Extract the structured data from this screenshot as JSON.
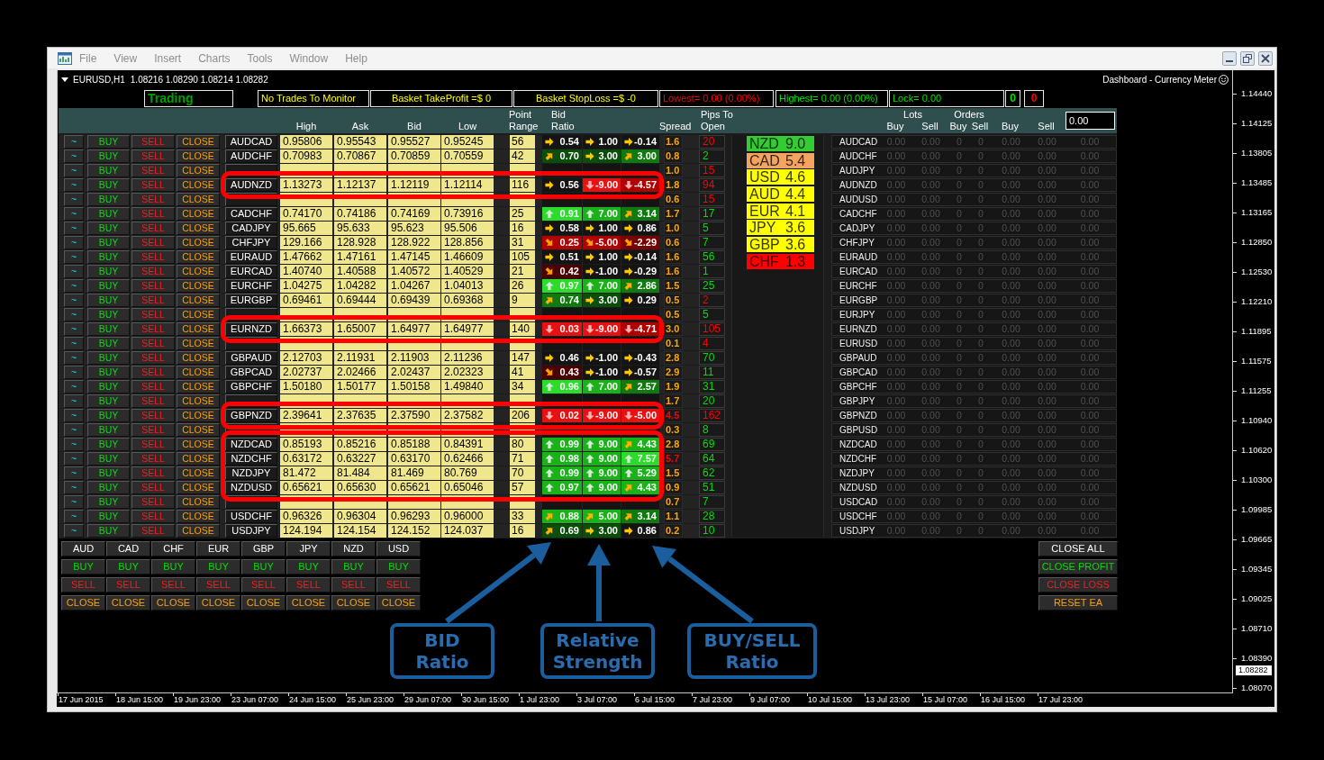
{
  "window": {
    "menu": [
      "File",
      "View",
      "Insert",
      "Charts",
      "Tools",
      "Window",
      "Help"
    ]
  },
  "chart": {
    "symbol": "EURUSD,H1",
    "quote": "1.08216 1.08290 1.08214 1.08282",
    "indicator": "Dashboard - Currency Meter",
    "price_labels": [
      "1.14440",
      "1.14125",
      "1.13805",
      "1.13485",
      "1.13165",
      "1.12850",
      "1.12530",
      "1.12210",
      "1.11895",
      "1.11575",
      "1.11255",
      "1.10940",
      "1.10620",
      "1.10300",
      "1.09985",
      "1.09665",
      "1.09345",
      "1.09025",
      "1.08710",
      "1.08390",
      "1.08070"
    ],
    "current_price": "1.08282",
    "time_labels": [
      "17 Jun 2015",
      "18 Jun 15:00",
      "19 Jun 23:00",
      "23 Jun 07:00",
      "24 Jun 15:00",
      "25 Jun 23:00",
      "29 Jun 07:00",
      "30 Jun 15:00",
      "1 Jul 23:00",
      "3 Jul 07:00",
      "6 Jul 15:00",
      "7 Jul 23:00",
      "9 Jul 07:00",
      "10 Jul 15:00",
      "13 Jul 23:00",
      "15 Jul 07:00",
      "16 Jul 15:00",
      "17 Jul 23:00"
    ]
  },
  "status_boxes": [
    {
      "text": "Trading",
      "color": "#00a000"
    },
    {
      "text": "No Trades To Monitor",
      "color": "#ffff00"
    },
    {
      "text": "Basket TakeProfit =$ 0",
      "color": "#ffff00"
    },
    {
      "text": "Basket StopLoss =$ -0",
      "color": "#ffff00"
    },
    {
      "text": "Lowest= 0.00 (0.00%)",
      "color": "#ff0000"
    },
    {
      "text": "Highest= 0.00 (0.00%)",
      "color": "#00e000"
    },
    {
      "text": "Lock= 0.00",
      "color": "#00e000"
    },
    {
      "text": "0",
      "color": "#00e000"
    },
    {
      "text": "0",
      "color": "#ff0000"
    }
  ],
  "table": {
    "headers": [
      [
        "High"
      ],
      [
        "Ask"
      ],
      [
        "Bid"
      ],
      [
        "Low"
      ],
      [
        "Point",
        "Range"
      ],
      [
        "Bid",
        "Ratio"
      ],
      [
        "Spread"
      ],
      [
        "Pips To",
        "Open"
      ]
    ],
    "rows": [
      {
        "buttons": [
          "~",
          "BUY",
          "SELL",
          "CLOSE"
        ],
        "pair": "AUDCAD",
        "high": "0.95806",
        "ask": "0.95543",
        "bid": "0.95527",
        "low": "0.95245",
        "range": "56",
        "ratios": [
          {
            "value": "0.54",
            "kind": "right",
            "color": "#141414"
          },
          {
            "value": "1.00",
            "kind": "right",
            "color": "#141414"
          },
          {
            "value": "-0.14",
            "kind": "right",
            "color": "#141414"
          }
        ],
        "spread": {
          "text": "1.6",
          "color": "#ffa500"
        },
        "pips": {
          "text": "20",
          "color": "#ff0000"
        },
        "highlighted": false
      },
      {
        "buttons": [
          "~",
          "BUY",
          "SELL",
          "CLOSE"
        ],
        "pair": "AUDCHF",
        "high": "0.70983",
        "ask": "0.70867",
        "bid": "0.70859",
        "low": "0.70559",
        "range": "42",
        "ratios": [
          {
            "value": "0.70",
            "kind": "up_right",
            "color": "#0b4d0b"
          },
          {
            "value": "3.00",
            "kind": "right",
            "color": "#0b4d0b"
          },
          {
            "value": "3.00",
            "kind": "up_right",
            "color": "#0f7a0f"
          }
        ],
        "spread": {
          "text": "0.8",
          "color": "#ffa500"
        },
        "pips": {
          "text": "2",
          "color": "#00e000"
        },
        "highlighted": false
      },
      {
        "buttons": [
          "~",
          "BUY",
          "SELL",
          "CLOSE"
        ],
        "spread": {
          "text": "1.0",
          "color": "#ffa500"
        },
        "pips": {
          "text": "15",
          "color": "#ff0000"
        },
        "highlighted": false
      },
      {
        "buttons": [
          "~",
          "BUY",
          "SELL",
          "CLOSE"
        ],
        "pair": "AUDNZD",
        "high": "1.13273",
        "ask": "1.12137",
        "bid": "1.12119",
        "low": "1.12114",
        "range": "116",
        "ratios": [
          {
            "value": "0.56",
            "kind": "right",
            "color": "#141414"
          },
          {
            "value": "-9.00",
            "kind": "down",
            "color": "#e81010"
          },
          {
            "value": "-4.57",
            "kind": "down",
            "color": "#b00000"
          }
        ],
        "spread": {
          "text": "1.8",
          "color": "#ffa500"
        },
        "pips": {
          "text": "94",
          "color": "#ff0000"
        },
        "highlighted": true
      },
      {
        "buttons": [
          "~",
          "BUY",
          "SELL",
          "CLOSE"
        ],
        "spread": {
          "text": "0.6",
          "color": "#ffa500"
        },
        "pips": {
          "text": "15",
          "color": "#ff0000"
        },
        "highlighted": false
      },
      {
        "buttons": [
          "~",
          "BUY",
          "SELL",
          "CLOSE"
        ],
        "pair": "CADCHF",
        "high": "0.74170",
        "ask": "0.74186",
        "bid": "0.74169",
        "low": "0.73916",
        "range": "25",
        "ratios": [
          {
            "value": "0.91",
            "kind": "up",
            "color": "#2bdc2b"
          },
          {
            "value": "7.00",
            "kind": "up",
            "color": "#19b219"
          },
          {
            "value": "3.14",
            "kind": "up_right",
            "color": "#0f7a0f"
          }
        ],
        "spread": {
          "text": "1.7",
          "color": "#ffa500"
        },
        "pips": {
          "text": "17",
          "color": "#00e000"
        },
        "highlighted": false
      },
      {
        "buttons": [
          "~",
          "BUY",
          "SELL",
          "CLOSE"
        ],
        "pair": "CADJPY",
        "high": "95.665",
        "ask": "95.633",
        "bid": "95.623",
        "low": "95.506",
        "range": "16",
        "ratios": [
          {
            "value": "0.58",
            "kind": "right",
            "color": "#141414"
          },
          {
            "value": "1.00",
            "kind": "right",
            "color": "#141414"
          },
          {
            "value": "0.86",
            "kind": "right",
            "color": "#141414"
          }
        ],
        "spread": {
          "text": "1.0",
          "color": "#ffa500"
        },
        "pips": {
          "text": "5",
          "color": "#00e000"
        },
        "highlighted": false
      },
      {
        "buttons": [
          "~",
          "BUY",
          "SELL",
          "CLOSE"
        ],
        "pair": "CHFJPY",
        "high": "129.166",
        "ask": "128.928",
        "bid": "128.922",
        "low": "128.856",
        "range": "31",
        "ratios": [
          {
            "value": "0.25",
            "kind": "down_right",
            "color": "#b00000"
          },
          {
            "value": "-5.00",
            "kind": "down_right",
            "color": "#b00000"
          },
          {
            "value": "-2.29",
            "kind": "down_right",
            "color": "#7a0000"
          }
        ],
        "spread": {
          "text": "0.6",
          "color": "#ffa500"
        },
        "pips": {
          "text": "7",
          "color": "#00e000"
        },
        "highlighted": false
      },
      {
        "buttons": [
          "~",
          "BUY",
          "SELL",
          "CLOSE"
        ],
        "pair": "EURAUD",
        "high": "1.47662",
        "ask": "1.47161",
        "bid": "1.47145",
        "low": "1.46609",
        "range": "105",
        "ratios": [
          {
            "value": "0.51",
            "kind": "right",
            "color": "#141414"
          },
          {
            "value": "1.00",
            "kind": "right",
            "color": "#141414"
          },
          {
            "value": "-0.14",
            "kind": "right",
            "color": "#141414"
          }
        ],
        "spread": {
          "text": "1.6",
          "color": "#ffa500"
        },
        "pips": {
          "text": "56",
          "color": "#00e000"
        },
        "highlighted": false
      },
      {
        "buttons": [
          "~",
          "BUY",
          "SELL",
          "CLOSE"
        ],
        "pair": "EURCAD",
        "high": "1.40740",
        "ask": "1.40588",
        "bid": "1.40572",
        "low": "1.40529",
        "range": "21",
        "ratios": [
          {
            "value": "0.42",
            "kind": "down_right",
            "color": "#4a0000"
          },
          {
            "value": "-1.00",
            "kind": "right",
            "color": "#141414"
          },
          {
            "value": "-0.29",
            "kind": "right",
            "color": "#141414"
          }
        ],
        "spread": {
          "text": "1.6",
          "color": "#ffa500"
        },
        "pips": {
          "text": "1",
          "color": "#00e000"
        },
        "highlighted": false
      },
      {
        "buttons": [
          "~",
          "BUY",
          "SELL",
          "CLOSE"
        ],
        "pair": "EURCHF",
        "high": "1.04275",
        "ask": "1.04282",
        "bid": "1.04267",
        "low": "1.04013",
        "range": "26",
        "ratios": [
          {
            "value": "0.97",
            "kind": "up",
            "color": "#2bdc2b"
          },
          {
            "value": "7.00",
            "kind": "up",
            "color": "#19b219"
          },
          {
            "value": "2.86",
            "kind": "up_right",
            "color": "#0f7a0f"
          }
        ],
        "spread": {
          "text": "1.5",
          "color": "#ffa500"
        },
        "pips": {
          "text": "25",
          "color": "#00e000"
        },
        "highlighted": false
      },
      {
        "buttons": [
          "~",
          "BUY",
          "SELL",
          "CLOSE"
        ],
        "pair": "EURGBP",
        "high": "0.69461",
        "ask": "0.69444",
        "bid": "0.69439",
        "low": "0.69368",
        "range": "9",
        "ratios": [
          {
            "value": "0.74",
            "kind": "up_right",
            "color": "#0f7a0f"
          },
          {
            "value": "3.00",
            "kind": "right",
            "color": "#0b4d0b"
          },
          {
            "value": "0.29",
            "kind": "right",
            "color": "#141414"
          }
        ],
        "spread": {
          "text": "0.5",
          "color": "#ffa500"
        },
        "pips": {
          "text": "2",
          "color": "#ff0000"
        },
        "highlighted": false
      },
      {
        "buttons": [
          "~",
          "BUY",
          "SELL",
          "CLOSE"
        ],
        "spread": {
          "text": "0.5",
          "color": "#ffa500"
        },
        "pips": {
          "text": "5",
          "color": "#00e000"
        },
        "highlighted": false
      },
      {
        "buttons": [
          "~",
          "BUY",
          "SELL",
          "CLOSE"
        ],
        "pair": "EURNZD",
        "high": "1.66373",
        "ask": "1.65007",
        "bid": "1.64977",
        "low": "1.64977",
        "range": "140",
        "ratios": [
          {
            "value": "0.03",
            "kind": "down",
            "color": "#e81010"
          },
          {
            "value": "-9.00",
            "kind": "down",
            "color": "#e81010"
          },
          {
            "value": "-4.71",
            "kind": "down",
            "color": "#b00000"
          }
        ],
        "spread": {
          "text": "3.0",
          "color": "#ffa500"
        },
        "pips": {
          "text": "105",
          "color": "#ff0000"
        },
        "highlighted": true
      },
      {
        "buttons": [
          "~",
          "BUY",
          "SELL",
          "CLOSE"
        ],
        "spread": {
          "text": "0.1",
          "color": "#ffa500"
        },
        "pips": {
          "text": "4",
          "color": "#ff0000"
        },
        "highlighted": false
      },
      {
        "buttons": [
          "~",
          "BUY",
          "SELL",
          "CLOSE"
        ],
        "pair": "GBPAUD",
        "high": "2.12703",
        "ask": "2.11931",
        "bid": "2.11903",
        "low": "2.11236",
        "range": "147",
        "ratios": [
          {
            "value": "0.46",
            "kind": "right",
            "color": "#141414"
          },
          {
            "value": "-1.00",
            "kind": "right",
            "color": "#141414"
          },
          {
            "value": "-0.43",
            "kind": "right",
            "color": "#141414"
          }
        ],
        "spread": {
          "text": "2.8",
          "color": "#ffa500"
        },
        "pips": {
          "text": "70",
          "color": "#00e000"
        },
        "highlighted": false
      },
      {
        "buttons": [
          "~",
          "BUY",
          "SELL",
          "CLOSE"
        ],
        "pair": "GBPCAD",
        "high": "2.02737",
        "ask": "2.02466",
        "bid": "2.02437",
        "low": "2.02323",
        "range": "41",
        "ratios": [
          {
            "value": "0.43",
            "kind": "down_right",
            "color": "#4a0000"
          },
          {
            "value": "-1.00",
            "kind": "right",
            "color": "#141414"
          },
          {
            "value": "-0.57",
            "kind": "right",
            "color": "#141414"
          }
        ],
        "spread": {
          "text": "2.9",
          "color": "#ffa500"
        },
        "pips": {
          "text": "11",
          "color": "#00e000"
        },
        "highlighted": false
      },
      {
        "buttons": [
          "~",
          "BUY",
          "SELL",
          "CLOSE"
        ],
        "pair": "GBPCHF",
        "high": "1.50180",
        "ask": "1.50177",
        "bid": "1.50158",
        "low": "1.49840",
        "range": "34",
        "ratios": [
          {
            "value": "0.96",
            "kind": "up",
            "color": "#2bdc2b"
          },
          {
            "value": "7.00",
            "kind": "up",
            "color": "#19b219"
          },
          {
            "value": "2.57",
            "kind": "up_right",
            "color": "#0f7a0f"
          }
        ],
        "spread": {
          "text": "1.9",
          "color": "#ffa500"
        },
        "pips": {
          "text": "31",
          "color": "#00e000"
        },
        "highlighted": false
      },
      {
        "buttons": [
          "~",
          "BUY",
          "SELL",
          "CLOSE"
        ],
        "spread": {
          "text": "1.7",
          "color": "#ffa500"
        },
        "pips": {
          "text": "20",
          "color": "#00e000"
        },
        "highlighted": false
      },
      {
        "buttons": [
          "~",
          "BUY",
          "SELL",
          "CLOSE"
        ],
        "pair": "GBPNZD",
        "high": "2.39641",
        "ask": "2.37635",
        "bid": "2.37590",
        "low": "2.37582",
        "range": "206",
        "ratios": [
          {
            "value": "0.02",
            "kind": "down",
            "color": "#e81010"
          },
          {
            "value": "-9.00",
            "kind": "down",
            "color": "#e81010"
          },
          {
            "value": "-5.00",
            "kind": "down",
            "color": "#e81010"
          }
        ],
        "spread": {
          "text": "4.5",
          "color": "#ff0000"
        },
        "pips": {
          "text": "162",
          "color": "#ff0000"
        },
        "highlighted": true
      },
      {
        "buttons": [
          "~",
          "BUY",
          "SELL",
          "CLOSE"
        ],
        "spread": {
          "text": "0.3",
          "color": "#ffa500"
        },
        "pips": {
          "text": "8",
          "color": "#00e000"
        },
        "highlighted": false
      },
      {
        "buttons": [
          "~",
          "BUY",
          "SELL",
          "CLOSE"
        ],
        "pair": "NZDCAD",
        "high": "0.85193",
        "ask": "0.85216",
        "bid": "0.85188",
        "low": "0.84391",
        "range": "80",
        "ratios": [
          {
            "value": "0.99",
            "kind": "up",
            "color": "#19b219"
          },
          {
            "value": "9.00",
            "kind": "up",
            "color": "#19b219"
          },
          {
            "value": "4.43",
            "kind": "up_right",
            "color": "#19b219"
          }
        ],
        "spread": {
          "text": "2.8",
          "color": "#ffa500"
        },
        "pips": {
          "text": "69",
          "color": "#00e000"
        },
        "highlighted": true
      },
      {
        "buttons": [
          "~",
          "BUY",
          "SELL",
          "CLOSE"
        ],
        "pair": "NZDCHF",
        "high": "0.63172",
        "ask": "0.63227",
        "bid": "0.63170",
        "low": "0.62466",
        "range": "71",
        "ratios": [
          {
            "value": "0.98",
            "kind": "up",
            "color": "#19b219"
          },
          {
            "value": "9.00",
            "kind": "up",
            "color": "#19b219"
          },
          {
            "value": "7.57",
            "kind": "up",
            "color": "#2bdc2b"
          }
        ],
        "spread": {
          "text": "5.7",
          "color": "#ff0000"
        },
        "pips": {
          "text": "64",
          "color": "#00e000"
        },
        "highlighted": true
      },
      {
        "buttons": [
          "~",
          "BUY",
          "SELL",
          "CLOSE"
        ],
        "pair": "NZDJPY",
        "high": "81.472",
        "ask": "81.484",
        "bid": "81.469",
        "low": "80.769",
        "range": "70",
        "ratios": [
          {
            "value": "0.99",
            "kind": "up",
            "color": "#19b219"
          },
          {
            "value": "9.00",
            "kind": "up",
            "color": "#19b219"
          },
          {
            "value": "5.29",
            "kind": "up",
            "color": "#19b219"
          }
        ],
        "spread": {
          "text": "1.5",
          "color": "#ffa500"
        },
        "pips": {
          "text": "62",
          "color": "#00e000"
        },
        "highlighted": true
      },
      {
        "buttons": [
          "~",
          "BUY",
          "SELL",
          "CLOSE"
        ],
        "pair": "NZDUSD",
        "high": "0.65621",
        "ask": "0.65630",
        "bid": "0.65621",
        "low": "0.65046",
        "range": "57",
        "ratios": [
          {
            "value": "0.97",
            "kind": "up",
            "color": "#19b219"
          },
          {
            "value": "9.00",
            "kind": "up",
            "color": "#19b219"
          },
          {
            "value": "4.43",
            "kind": "up_right",
            "color": "#19b219"
          }
        ],
        "spread": {
          "text": "0.9",
          "color": "#ffa500"
        },
        "pips": {
          "text": "51",
          "color": "#00e000"
        },
        "highlighted": true
      },
      {
        "buttons": [
          "~",
          "BUY",
          "SELL",
          "CLOSE"
        ],
        "spread": {
          "text": "0.7",
          "color": "#ffa500"
        },
        "pips": {
          "text": "7",
          "color": "#00e000"
        },
        "highlighted": false
      },
      {
        "buttons": [
          "~",
          "BUY",
          "SELL",
          "CLOSE"
        ],
        "pair": "USDCHF",
        "high": "0.96326",
        "ask": "0.96304",
        "bid": "0.96293",
        "low": "0.96000",
        "range": "33",
        "ratios": [
          {
            "value": "0.88",
            "kind": "up_right",
            "color": "#19b219"
          },
          {
            "value": "5.00",
            "kind": "up_right",
            "color": "#19b219"
          },
          {
            "value": "3.14",
            "kind": "up_right",
            "color": "#0f7a0f"
          }
        ],
        "spread": {
          "text": "1.1",
          "color": "#ffa500"
        },
        "pips": {
          "text": "28",
          "color": "#00e000"
        },
        "highlighted": false
      },
      {
        "buttons": [
          "~",
          "BUY",
          "SELL",
          "CLOSE"
        ],
        "pair": "USDJPY",
        "high": "124.194",
        "ask": "124.154",
        "bid": "124.152",
        "low": "124.037",
        "range": "16",
        "ratios": [
          {
            "value": "0.69",
            "kind": "up_right",
            "color": "#0b4d0b"
          },
          {
            "value": "3.00",
            "kind": "right",
            "color": "#0b4d0b"
          },
          {
            "value": "0.86",
            "kind": "right",
            "color": "#141414"
          }
        ],
        "spread": {
          "text": "0.2",
          "color": "#ffa500"
        },
        "pips": {
          "text": "10",
          "color": "#00e000"
        },
        "highlighted": false
      }
    ]
  },
  "strength": [
    {
      "currency": "NZD",
      "value": "9.0",
      "color": "#33cc33"
    },
    {
      "currency": "CAD",
      "value": "5.4",
      "color": "#f4a460"
    },
    {
      "currency": "USD",
      "value": "4.6",
      "color": "#ffff00"
    },
    {
      "currency": "AUD",
      "value": "4.4",
      "color": "#ffff00"
    },
    {
      "currency": "EUR",
      "value": "4.1",
      "color": "#ffff00"
    },
    {
      "currency": "JPY",
      "value": "3.6",
      "color": "#ffff00"
    },
    {
      "currency": "GBP",
      "value": "3.6",
      "color": "#ffff00"
    },
    {
      "currency": "CHF",
      "value": "1.3",
      "color": "#ff0000"
    }
  ],
  "positions": {
    "header": {
      "groups": [
        {
          "title": "Lots",
          "columns": [
            "Buy",
            "Sell"
          ]
        },
        {
          "title": "Orders",
          "columns": [
            "Buy",
            "Sell"
          ]
        }
      ],
      "columns": [
        "Buy",
        "Sell"
      ],
      "input_value": "0.00"
    },
    "rows": [
      {
        "pair": "AUDCAD",
        "values": [
          "0.00",
          "0.00",
          "0",
          "0",
          "0.00",
          "0.00",
          "0.00"
        ]
      },
      {
        "pair": "AUDCHF",
        "values": [
          "0.00",
          "0.00",
          "0",
          "0",
          "0.00",
          "0.00",
          "0.00"
        ]
      },
      {
        "pair": "AUDJPY",
        "values": [
          "0.00",
          "0.00",
          "0",
          "0",
          "0.00",
          "0.00",
          "0.00"
        ]
      },
      {
        "pair": "AUDNZD",
        "values": [
          "0.00",
          "0.00",
          "0",
          "0",
          "0.00",
          "0.00",
          "0.00"
        ]
      },
      {
        "pair": "AUDUSD",
        "values": [
          "0.00",
          "0.00",
          "0",
          "0",
          "0.00",
          "0.00",
          "0.00"
        ]
      },
      {
        "pair": "CADCHF",
        "values": [
          "0.00",
          "0.00",
          "0",
          "0",
          "0.00",
          "0.00",
          "0.00"
        ]
      },
      {
        "pair": "CADJPY",
        "values": [
          "0.00",
          "0.00",
          "0",
          "0",
          "0.00",
          "0.00",
          "0.00"
        ]
      },
      {
        "pair": "CHFJPY",
        "values": [
          "0.00",
          "0.00",
          "0",
          "0",
          "0.00",
          "0.00",
          "0.00"
        ]
      },
      {
        "pair": "EURAUD",
        "values": [
          "0.00",
          "0.00",
          "0",
          "0",
          "0.00",
          "0.00",
          "0.00"
        ]
      },
      {
        "pair": "EURCAD",
        "values": [
          "0.00",
          "0.00",
          "0",
          "0",
          "0.00",
          "0.00",
          "0.00"
        ]
      },
      {
        "pair": "EURCHF",
        "values": [
          "0.00",
          "0.00",
          "0",
          "0",
          "0.00",
          "0.00",
          "0.00"
        ]
      },
      {
        "pair": "EURGBP",
        "values": [
          "0.00",
          "0.00",
          "0",
          "0",
          "0.00",
          "0.00",
          "0.00"
        ]
      },
      {
        "pair": "EURJPY",
        "values": [
          "0.00",
          "0.00",
          "0",
          "0",
          "0.00",
          "0.00",
          "0.00"
        ]
      },
      {
        "pair": "EURNZD",
        "values": [
          "0.00",
          "0.00",
          "0",
          "0",
          "0.00",
          "0.00",
          "0.00"
        ]
      },
      {
        "pair": "EURUSD",
        "values": [
          "0.00",
          "0.00",
          "0",
          "0",
          "0.00",
          "0.00",
          "0.00"
        ]
      },
      {
        "pair": "GBPAUD",
        "values": [
          "0.00",
          "0.00",
          "0",
          "0",
          "0.00",
          "0.00",
          "0.00"
        ]
      },
      {
        "pair": "GBPCAD",
        "values": [
          "0.00",
          "0.00",
          "0",
          "0",
          "0.00",
          "0.00",
          "0.00"
        ]
      },
      {
        "pair": "GBPCHF",
        "values": [
          "0.00",
          "0.00",
          "0",
          "0",
          "0.00",
          "0.00",
          "0.00"
        ]
      },
      {
        "pair": "GBPJPY",
        "values": [
          "0.00",
          "0.00",
          "0",
          "0",
          "0.00",
          "0.00",
          "0.00"
        ]
      },
      {
        "pair": "GBPNZD",
        "values": [
          "0.00",
          "0.00",
          "0",
          "0",
          "0.00",
          "0.00",
          "0.00"
        ]
      },
      {
        "pair": "GBPUSD",
        "values": [
          "0.00",
          "0.00",
          "0",
          "0",
          "0.00",
          "0.00",
          "0.00"
        ]
      },
      {
        "pair": "NZDCAD",
        "values": [
          "0.00",
          "0.00",
          "0",
          "0",
          "0.00",
          "0.00",
          "0.00"
        ]
      },
      {
        "pair": "NZDCHF",
        "values": [
          "0.00",
          "0.00",
          "0",
          "0",
          "0.00",
          "0.00",
          "0.00"
        ]
      },
      {
        "pair": "NZDJPY",
        "values": [
          "0.00",
          "0.00",
          "0",
          "0",
          "0.00",
          "0.00",
          "0.00"
        ]
      },
      {
        "pair": "NZDUSD",
        "values": [
          "0.00",
          "0.00",
          "0",
          "0",
          "0.00",
          "0.00",
          "0.00"
        ]
      },
      {
        "pair": "USDCAD",
        "values": [
          "0.00",
          "0.00",
          "0",
          "0",
          "0.00",
          "0.00",
          "0.00"
        ]
      },
      {
        "pair": "USDCHF",
        "values": [
          "0.00",
          "0.00",
          "0",
          "0",
          "0.00",
          "0.00",
          "0.00"
        ]
      },
      {
        "pair": "USDJPY",
        "values": [
          "0.00",
          "0.00",
          "0",
          "0",
          "0.00",
          "0.00",
          "0.00"
        ]
      }
    ]
  },
  "bottom": {
    "currencies": [
      {
        "currency": "AUD",
        "actions": [
          "BUY",
          "SELL",
          "CLOSE"
        ]
      },
      {
        "currency": "CAD",
        "actions": [
          "BUY",
          "SELL",
          "CLOSE"
        ]
      },
      {
        "currency": "CHF",
        "actions": [
          "BUY",
          "SELL",
          "CLOSE"
        ]
      },
      {
        "currency": "EUR",
        "actions": [
          "BUY",
          "SELL",
          "CLOSE"
        ]
      },
      {
        "currency": "GBP",
        "actions": [
          "BUY",
          "SELL",
          "CLOSE"
        ]
      },
      {
        "currency": "JPY",
        "actions": [
          "BUY",
          "SELL",
          "CLOSE"
        ]
      },
      {
        "currency": "NZD",
        "actions": [
          "BUY",
          "SELL",
          "CLOSE"
        ]
      },
      {
        "currency": "USD",
        "actions": [
          "BUY",
          "SELL",
          "CLOSE"
        ]
      }
    ],
    "account_buttons": [
      {
        "label": "CLOSE ALL",
        "kind": "close_all"
      },
      {
        "label": "CLOSE PROFIT",
        "kind": "close_profit"
      },
      {
        "label": "CLOSE LOSS",
        "kind": "close_loss"
      },
      {
        "label": "RESET EA",
        "kind": "reset"
      }
    ]
  },
  "callouts": [
    {
      "lines": [
        "BID",
        "Ratio"
      ]
    },
    {
      "lines": [
        "Relative",
        "Strength"
      ]
    },
    {
      "lines": [
        "BUY/SELL",
        "Ratio"
      ]
    }
  ]
}
